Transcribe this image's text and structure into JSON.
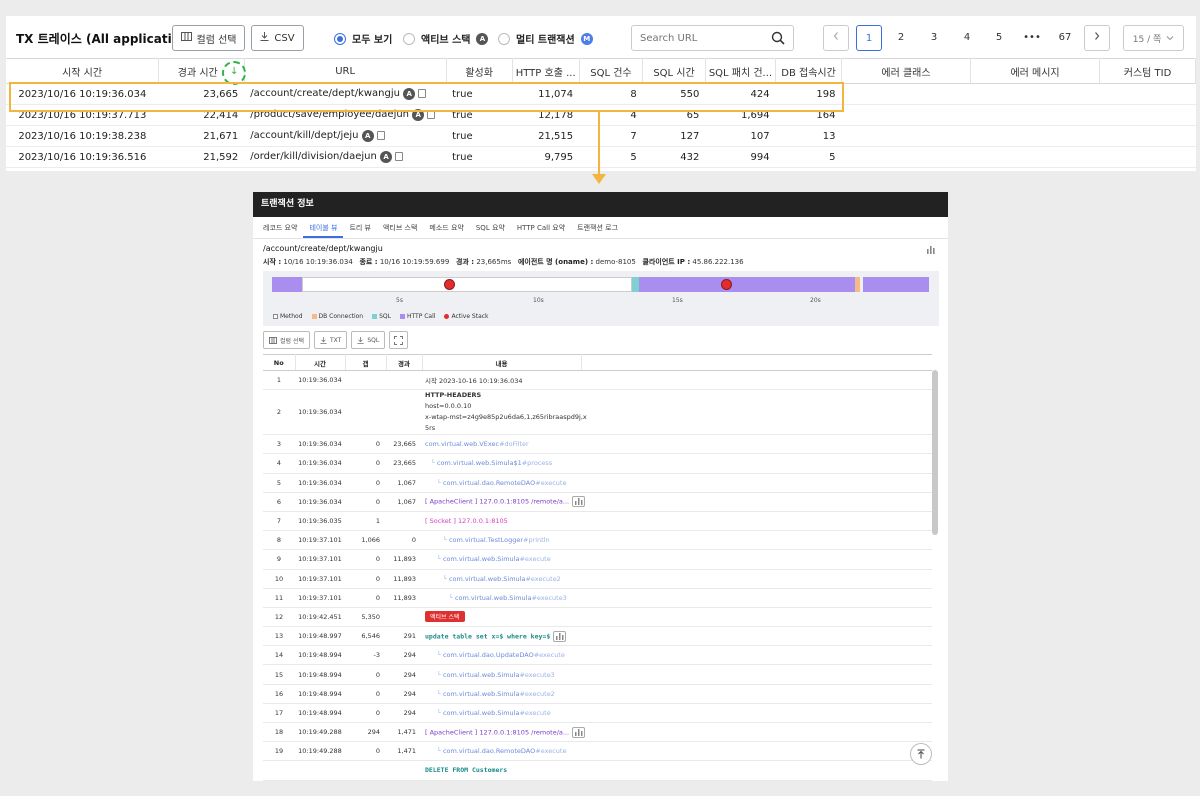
{
  "top": {
    "title": "TX 트레이스 (All applications)",
    "column_select_label": "컬럼 선택",
    "csv_label": "CSV",
    "filters": [
      {
        "label": "모두 보기",
        "selected": true,
        "badge": ""
      },
      {
        "label": "액티브 스택",
        "selected": false,
        "badge": "A"
      },
      {
        "label": "멀티 트랜잭션",
        "selected": false,
        "badge": "M"
      }
    ],
    "search_placeholder": "Search URL",
    "pages": [
      "1",
      "2",
      "3",
      "4",
      "5",
      "•••",
      "67"
    ],
    "current_page": "1",
    "per_page": "15 / 쪽"
  },
  "tx_table": {
    "columns": [
      "시작 시간",
      "경과 시간",
      "URL",
      "활성화",
      "HTTP 호출 ...",
      "SQL 건수",
      "SQL 시간",
      "SQL 패치 건...",
      "DB 접속시간",
      "에러 클래스",
      "에러 메시지",
      "커스텀 TID"
    ],
    "sort_icon": "sort-down-arrow",
    "rows": [
      {
        "start": "2023/10/16 10:19:36.034",
        "elapsed": "23,665",
        "url": "/account/create/dept/kwangju",
        "active": "true",
        "http": "11,074",
        "sql_count": "8",
        "sql_time": "550",
        "sql_fetch": "424",
        "db_conn": "198"
      },
      {
        "start": "2023/10/16 10:19:37.713",
        "elapsed": "22,414",
        "url": "/product/save/employee/daejun",
        "active": "true",
        "http": "12,178",
        "sql_count": "4",
        "sql_time": "65",
        "sql_fetch": "1,694",
        "db_conn": "164"
      },
      {
        "start": "2023/10/16 10:19:38.238",
        "elapsed": "21,671",
        "url": "/account/kill/dept/jeju",
        "active": "true",
        "http": "21,515",
        "sql_count": "7",
        "sql_time": "127",
        "sql_fetch": "107",
        "db_conn": "13"
      },
      {
        "start": "2023/10/16 10:19:36.516",
        "elapsed": "21,592",
        "url": "/order/kill/division/daejun",
        "active": "true",
        "http": "9,795",
        "sql_count": "5",
        "sql_time": "432",
        "sql_fetch": "994",
        "db_conn": "5"
      }
    ],
    "url_badge": "A"
  },
  "detail": {
    "title": "트랜잭션 정보",
    "tabs": [
      "레코드 요약",
      "테이블 뷰",
      "트리 뷰",
      "액티브 스택",
      "메소드 요약",
      "SQL 요약",
      "HTTP Call 요약",
      "트랜잭션 로그"
    ],
    "active_tab": "테이블 뷰",
    "url": "/account/create/dept/kwangju",
    "meta": {
      "start_label": "시작 :",
      "start": "10/16 10:19:36.034",
      "end_label": "종료 :",
      "end": "10/16 10:19:59.699",
      "elapsed_label": "경과 :",
      "elapsed": "23,665ms",
      "agent_label": "에이전트 명 (oname) :",
      "agent": "demo-8105",
      "client_label": "클라이언트 IP :",
      "client": "45.86.222.136"
    },
    "timeline_ticks": [
      "5s",
      "10s",
      "15s",
      "20s"
    ],
    "legend": [
      {
        "label": "Method",
        "color": "#ffffff"
      },
      {
        "label": "DB Connection",
        "color": "#f5b98a"
      },
      {
        "label": "SQL",
        "color": "#7fd1d1"
      },
      {
        "label": "HTTP Call",
        "color": "#a98ef0"
      },
      {
        "label": "Active Stack",
        "color": "#e12d2d"
      }
    ],
    "buttons": [
      "컬럼 선택",
      "TXT",
      "SQL"
    ],
    "columns": [
      "No",
      "시간",
      "갭",
      "경과",
      "내용"
    ],
    "rows": [
      {
        "no": "1",
        "time": "10:19:36.034",
        "gap": "",
        "elapsed": "",
        "kind": "text",
        "content": "시작  2023-10-16 10:19:36.034"
      },
      {
        "no": "2",
        "time": "10:19:36.034",
        "gap": "",
        "elapsed": "",
        "kind": "headers",
        "content": "HTTP-HEADERS",
        "extra1": "host=0.0.0.10",
        "extra2": "x-wtap-mst=z4g9e85p2u6da6,1,z65ribraaspd9j,x",
        "extra3": "5rs"
      },
      {
        "no": "3",
        "time": "10:19:36.034",
        "gap": "0",
        "elapsed": "23,665",
        "kind": "method",
        "indent": 0,
        "content": "com.virtual.web.VExec",
        "hash": "#doFilter"
      },
      {
        "no": "4",
        "time": "10:19:36.034",
        "gap": "0",
        "elapsed": "23,665",
        "kind": "method",
        "indent": 1,
        "content": "com.virtual.web.Simula$1",
        "hash": "#process"
      },
      {
        "no": "5",
        "time": "10:19:36.034",
        "gap": "0",
        "elapsed": "1,067",
        "kind": "method",
        "indent": 2,
        "content": "com.virtual.dao.RemoteDAO",
        "hash": "#execute"
      },
      {
        "no": "6",
        "time": "10:19:36.034",
        "gap": "0",
        "elapsed": "1,067",
        "kind": "apache",
        "content": "[ ApacheClient ] 127.0.0.1:8105 /remote/a..."
      },
      {
        "no": "7",
        "time": "10:19:36.035",
        "gap": "1",
        "elapsed": "",
        "kind": "socket",
        "content": "[ Socket ] 127.0.0.1:8105"
      },
      {
        "no": "8",
        "time": "10:19:37.101",
        "gap": "1,066",
        "elapsed": "0",
        "kind": "method",
        "indent": 3,
        "content": "com.virtual.TestLogger",
        "hash": "#println"
      },
      {
        "no": "9",
        "time": "10:19:37.101",
        "gap": "0",
        "elapsed": "11,893",
        "kind": "method",
        "indent": 2,
        "content": "com.virtual.web.Simula",
        "hash": "#execute"
      },
      {
        "no": "10",
        "time": "10:19:37.101",
        "gap": "0",
        "elapsed": "11,893",
        "kind": "method",
        "indent": 3,
        "content": "com.virtual.web.Simula",
        "hash": "#execute2"
      },
      {
        "no": "11",
        "time": "10:19:37.101",
        "gap": "0",
        "elapsed": "11,893",
        "kind": "method",
        "indent": 4,
        "content": "com.virtual.web.Simula",
        "hash": "#execute3"
      },
      {
        "no": "12",
        "time": "10:19:42.451",
        "gap": "5,350",
        "elapsed": "",
        "kind": "stack",
        "content": "액티브 스택"
      },
      {
        "no": "13",
        "time": "10:19:48.997",
        "gap": "6,546",
        "elapsed": "291",
        "kind": "sql",
        "content": "update table set x=$ where key=$"
      },
      {
        "no": "14",
        "time": "10:19:48.994",
        "gap": "-3",
        "elapsed": "294",
        "kind": "method",
        "indent": 2,
        "content": "com.virtual.dao.UpdateDAO",
        "hash": "#execute"
      },
      {
        "no": "15",
        "time": "10:19:48.994",
        "gap": "0",
        "elapsed": "294",
        "kind": "method",
        "indent": 2,
        "content": "com.virtual.web.Simula",
        "hash": "#execute3"
      },
      {
        "no": "16",
        "time": "10:19:48.994",
        "gap": "0",
        "elapsed": "294",
        "kind": "method",
        "indent": 2,
        "content": "com.virtual.web.Simula",
        "hash": "#execute2"
      },
      {
        "no": "17",
        "time": "10:19:48.994",
        "gap": "0",
        "elapsed": "294",
        "kind": "method",
        "indent": 2,
        "content": "com.virtual.web.Simula",
        "hash": "#execute"
      },
      {
        "no": "18",
        "time": "10:19:49.288",
        "gap": "294",
        "elapsed": "1,471",
        "kind": "apache",
        "content": "[ ApacheClient ] 127.0.0.1:8105 /remote/a..."
      },
      {
        "no": "19",
        "time": "10:19:49.288",
        "gap": "0",
        "elapsed": "1,471",
        "kind": "method",
        "indent": 2,
        "content": "com.virtual.dao.RemoteDAO",
        "hash": "#execute"
      },
      {
        "no": "",
        "time": "",
        "gap": "",
        "elapsed": "",
        "kind": "sql",
        "content": "DELETE FROM Customers"
      }
    ]
  }
}
